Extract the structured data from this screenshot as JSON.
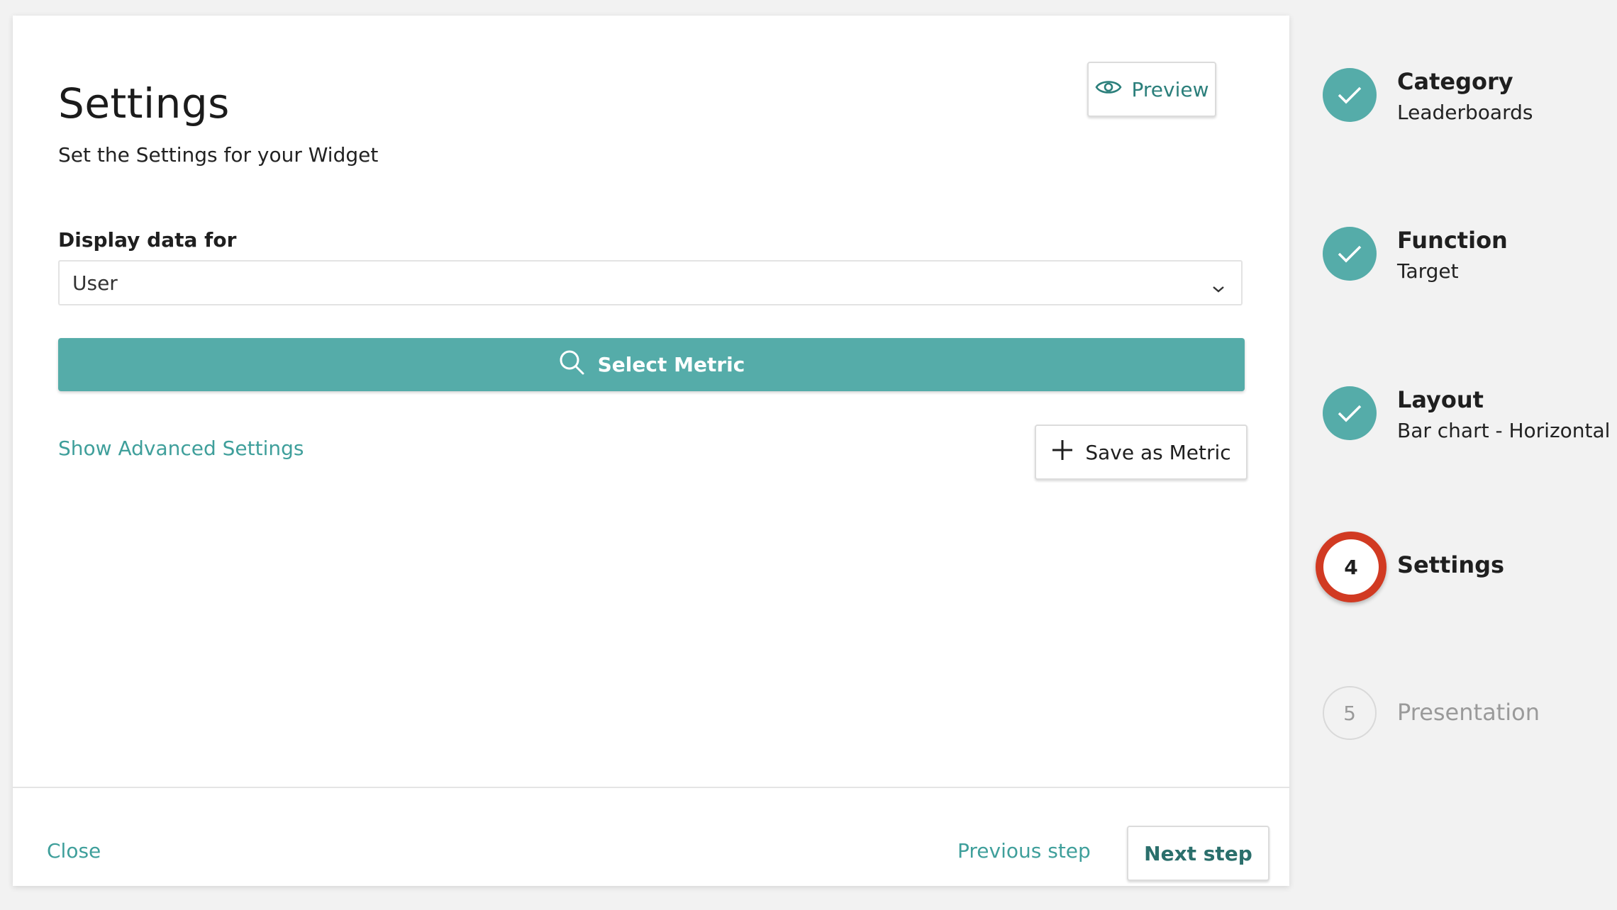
{
  "header": {
    "title": "Settings",
    "subtitle": "Set the Settings for your Widget",
    "preview_label": "Preview"
  },
  "form": {
    "display_label": "Display data for",
    "display_value": "User",
    "select_metric_label": "Select Metric",
    "advanced_label": "Show Advanced Settings",
    "save_metric_label": "Save as Metric"
  },
  "footer": {
    "close_label": "Close",
    "previous_label": "Previous step",
    "next_label": "Next step"
  },
  "stepper": {
    "steps": [
      {
        "title": "Category",
        "subtitle": "Leaderboards",
        "status": "done"
      },
      {
        "title": "Function",
        "subtitle": "Target",
        "status": "done"
      },
      {
        "title": "Layout",
        "subtitle": "Bar chart - Horizontal",
        "status": "done"
      },
      {
        "number": "4",
        "title": "Settings",
        "status": "current"
      },
      {
        "number": "5",
        "title": "Presentation",
        "status": "todo"
      }
    ]
  },
  "colors": {
    "accent": "#55aca9",
    "link": "#3f9f9b",
    "highlight": "#d13a22"
  }
}
